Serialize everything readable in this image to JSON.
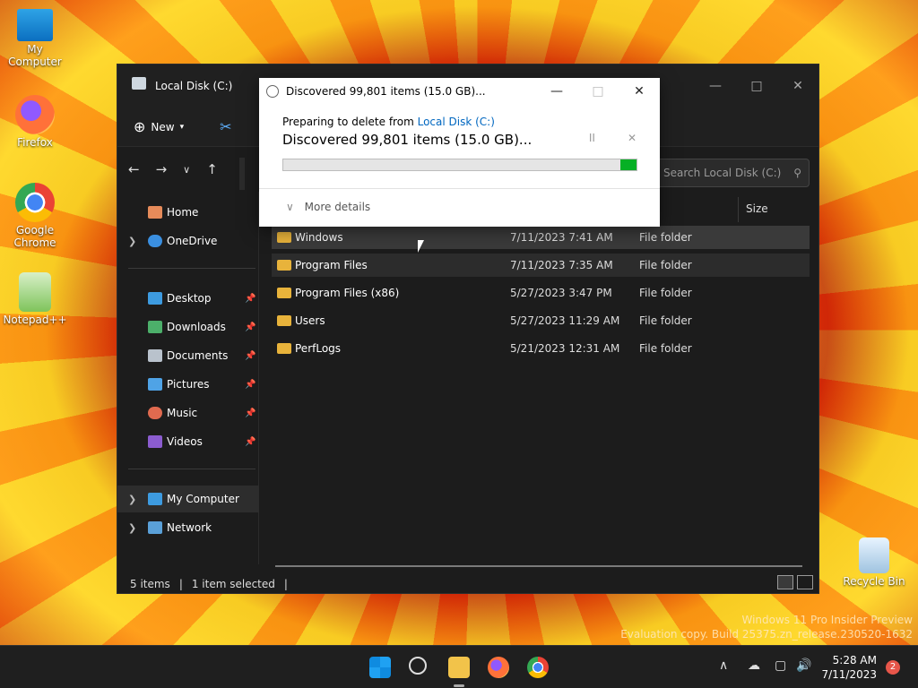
{
  "desktop": {
    "icons": [
      {
        "label": "My Computer",
        "icon": "monitor-icon"
      },
      {
        "label": "Firefox",
        "icon": "firefox-icon"
      },
      {
        "label": "Google Chrome",
        "icon": "chrome-icon"
      },
      {
        "label": "Notepad++",
        "icon": "notepad-plus-plus-icon"
      },
      {
        "label": "Recycle Bin",
        "icon": "recycle-bin-icon"
      }
    ],
    "watermark": {
      "line1": "Windows 11 Pro Insider Preview",
      "line2": "Evaluation copy. Build 25375.zn_release.230520-1632"
    }
  },
  "explorer": {
    "title": "Local Disk (C:)",
    "new_label": "New",
    "search_placeholder": "Search Local Disk (C:)",
    "column_size": "Size",
    "sidebar": {
      "home": "Home",
      "onedrive": "OneDrive",
      "desktop": "Desktop",
      "downloads": "Downloads",
      "documents": "Documents",
      "pictures": "Pictures",
      "music": "Music",
      "videos": "Videos",
      "my_computer": "My Computer",
      "network": "Network"
    },
    "rows": [
      {
        "name": "Windows",
        "date": "7/11/2023 7:41 AM",
        "type": "File folder"
      },
      {
        "name": "Program Files",
        "date": "7/11/2023 7:35 AM",
        "type": "File folder"
      },
      {
        "name": "Program Files (x86)",
        "date": "5/27/2023 3:47 PM",
        "type": "File folder"
      },
      {
        "name": "Users",
        "date": "5/27/2023 11:29 AM",
        "type": "File folder"
      },
      {
        "name": "PerfLogs",
        "date": "5/21/2023 12:31 AM",
        "type": "File folder"
      }
    ],
    "status": {
      "items": "5 items",
      "selected": "1 item selected"
    }
  },
  "dialog": {
    "title": "Discovered 99,801 items (15.0 GB)...",
    "preparing_prefix": "Preparing to delete from",
    "preparing_link": "Local Disk (C:)",
    "discovered": "Discovered 99,801 items (15.0 GB)...",
    "pause_symbol": "II",
    "cancel_symbol": "✕",
    "more_details": "More details",
    "progress_fraction": 0.05
  },
  "taskbar": {
    "time": "5:28 AM",
    "date": "7/11/2023",
    "notification_count": "2",
    "apps": [
      "start-icon",
      "search-icon",
      "file-explorer-icon",
      "firefox-icon",
      "chrome-icon"
    ]
  }
}
